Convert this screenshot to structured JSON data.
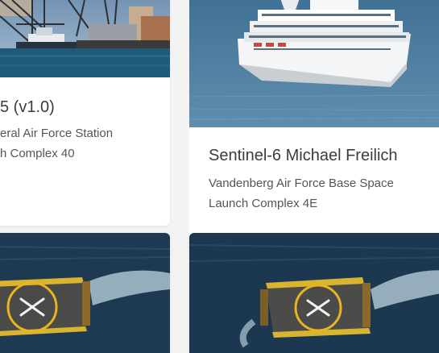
{
  "cards": [
    {
      "name": "card-falcon9-ccafs",
      "title": "5 (v1.0)",
      "site_line1": "eral Air Force Station",
      "site_line2": "h Complex 40",
      "image": "harbor-crane-photo"
    },
    {
      "name": "card-sentinel6",
      "title": "Sentinel-6 Michael Freilich",
      "site_line1": "Vandenberg Air Force Base Space",
      "site_line2": "Launch Complex 4E",
      "image": "recovery-ship-photo"
    },
    {
      "name": "card-drone-ship-left",
      "image": "drone-ship-photo"
    },
    {
      "name": "card-drone-ship-right",
      "image": "drone-ship-photo"
    }
  ],
  "colors": {
    "page_background": "#f3f3f3",
    "card_background": "#ffffff",
    "title_text": "#3c3c3c",
    "body_text": "#555555",
    "ocean": "#1f3f5a",
    "deck_yellow": "#e8b520"
  }
}
